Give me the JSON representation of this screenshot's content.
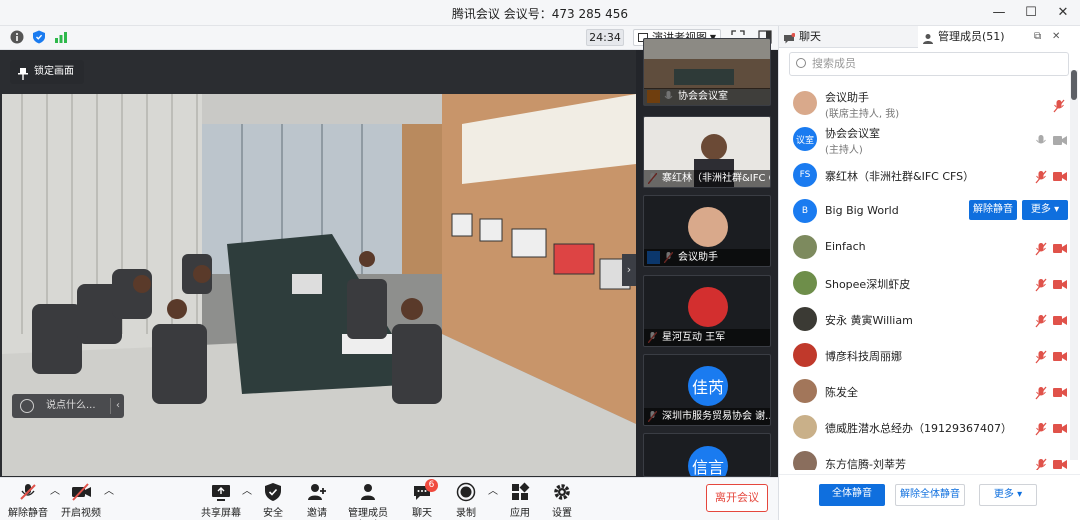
{
  "window": {
    "title": "腾讯会议 会议号：473 285 456",
    "minimize": "—",
    "maximize": "☐",
    "close": "✕"
  },
  "toolbar": {
    "timer": "24:34",
    "view_label": "演讲者视图"
  },
  "stage": {
    "lock_label": "锁定画面",
    "say_placeholder": "说点什么..."
  },
  "thumbnails": [
    {
      "label": "协会会议室"
    },
    {
      "label": "寨红林（非洲社群&IFC CFS）"
    },
    {
      "label": "会议助手"
    },
    {
      "label": "星河互动 王军"
    },
    {
      "label": "深圳市服务贸易协会 谢...",
      "avatar_text": "佳芮",
      "avatar_color": "#1a7bf0"
    },
    {
      "label": "",
      "avatar_text": "信言",
      "avatar_color": "#1a7bf0"
    }
  ],
  "bottombar": {
    "unmute": "解除静音",
    "start_video": "开启视频",
    "share": "共享屏幕",
    "security": "安全",
    "invite": "邀请",
    "members": "管理成员(51)",
    "chat": "聊天",
    "chat_badge": "6",
    "record": "录制",
    "apps": "应用",
    "settings": "设置",
    "leave": "离开会议"
  },
  "panel": {
    "tab_chat": "聊天",
    "tab_members": "管理成员(51)",
    "search_placeholder": "搜索成员",
    "members": [
      {
        "name": "会议助手",
        "role": "(联席主持人, 我)",
        "avatar_color": "#d9a98b"
      },
      {
        "name": "协会会议室",
        "role": "(主持人)",
        "avatar_text": "议室",
        "avatar_color": "#1a7bf0"
      },
      {
        "name": "寨红林（非洲社群&IFC CFS）",
        "role": "",
        "avatar_text": "FS",
        "avatar_color": "#1a7bf0"
      },
      {
        "name": "Big Big World",
        "role": "",
        "avatar_text": "B",
        "avatar_color": "#1a7bf0",
        "btn_unmute": "解除静音",
        "btn_more": "更多"
      },
      {
        "name": "Einfach",
        "role": "",
        "avatar_color": "#7d8a5e"
      },
      {
        "name": "Shopee深圳虾皮",
        "role": "",
        "avatar_color": "#6e8e4a"
      },
      {
        "name": "安永 黄寅William",
        "role": "",
        "avatar_color": "#3b3a34"
      },
      {
        "name": "博彦科技周丽娜",
        "role": "",
        "avatar_color": "#c0392b"
      },
      {
        "name": "陈发全",
        "role": "",
        "avatar_color": "#a2765a"
      },
      {
        "name": "德威胜潜水总经办（19129367407）",
        "role": "",
        "avatar_color": "#c9b089"
      },
      {
        "name": "东方信腾-刘莘芳",
        "role": "",
        "avatar_color": "#8a6e5d"
      }
    ],
    "footer": {
      "mute_all": "全体静音",
      "unmute_all": "解除全体静音",
      "more": "更多"
    }
  },
  "colors": {
    "accent": "#0f6fde",
    "danger": "#e5473d",
    "muted_red": "#e0524a"
  }
}
